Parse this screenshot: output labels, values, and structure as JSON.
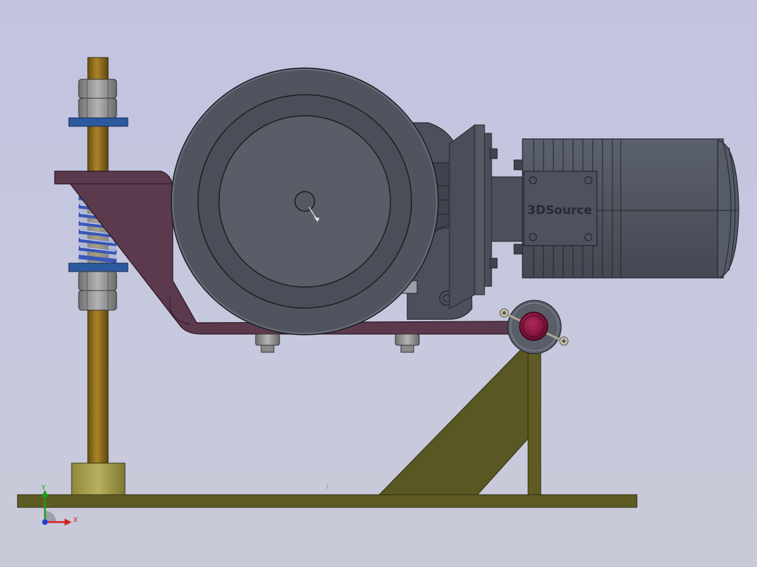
{
  "model": {
    "brand_text": "3DSource"
  },
  "triad": {
    "x_label": "X",
    "y_label": "Y",
    "x_color": "#d42020",
    "y_color": "#16a016",
    "z_color": "#2040d0"
  },
  "colors": {
    "background": "#c4c5df",
    "frame_olive": "#5e5c24",
    "bracket_maroon": "#5c3a4d",
    "motor_gray": "#4f5463",
    "rod_bronze": "#8a6a18",
    "spring_blue": "#3a56b8",
    "washer_blue": "#2c5aa0",
    "knob_magenta": "#8a1040"
  },
  "icons": {
    "triad": "coordinate-triad-icon"
  }
}
